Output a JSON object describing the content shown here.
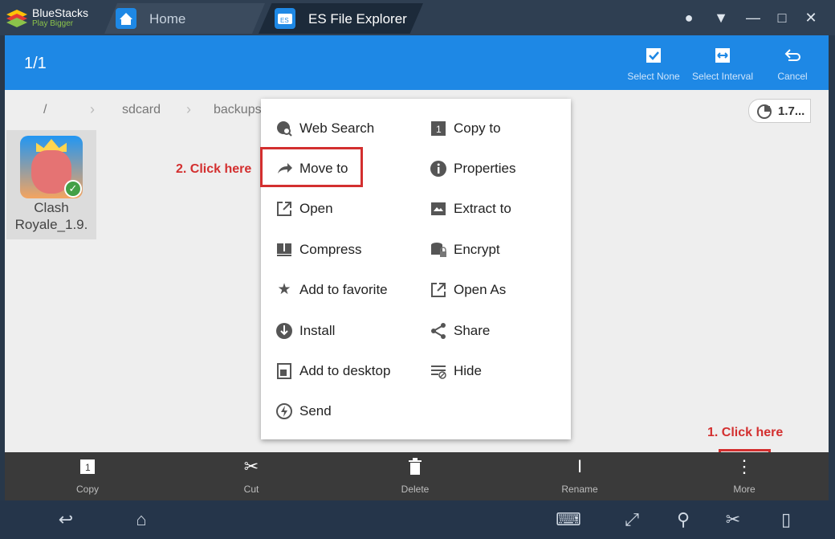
{
  "window": {
    "brand_name": "BlueStacks",
    "brand_tagline": "Play Bigger",
    "tabs": [
      {
        "label": "Home"
      },
      {
        "label": "ES File Explorer"
      }
    ]
  },
  "header": {
    "selection_count": "1/1",
    "actions": [
      {
        "label": "Select None",
        "icon": "checkbox-icon"
      },
      {
        "label": "Select Interval",
        "icon": "interval-icon"
      },
      {
        "label": "Cancel",
        "icon": "undo-icon"
      }
    ]
  },
  "breadcrumb": [
    "/",
    "sdcard",
    "backups"
  ],
  "storage": {
    "value": "1.7..."
  },
  "file": {
    "name": "Clash Royale_1.9."
  },
  "menu": {
    "left": [
      {
        "label": "Web Search",
        "icon": "globe-search-icon"
      },
      {
        "label": "Move to",
        "icon": "move-arrow-icon"
      },
      {
        "label": "Open",
        "icon": "open-external-icon"
      },
      {
        "label": "Compress",
        "icon": "compress-icon"
      },
      {
        "label": "Add to favorite",
        "icon": "star-icon"
      },
      {
        "label": "Install",
        "icon": "install-icon"
      },
      {
        "label": "Add to desktop",
        "icon": "desktop-shortcut-icon"
      },
      {
        "label": "Send",
        "icon": "send-icon"
      }
    ],
    "right": [
      {
        "label": "Copy to",
        "icon": "copy-icon"
      },
      {
        "label": "Properties",
        "icon": "info-icon"
      },
      {
        "label": "Extract to",
        "icon": "extract-icon"
      },
      {
        "label": "Encrypt",
        "icon": "encrypt-icon"
      },
      {
        "label": "Open As",
        "icon": "open-as-icon"
      },
      {
        "label": "Share",
        "icon": "share-icon"
      },
      {
        "label": "Hide",
        "icon": "hide-icon"
      }
    ]
  },
  "annotations": {
    "step1": "1. Click here",
    "step2": "2. Click here"
  },
  "toolbar": [
    {
      "label": "Copy",
      "icon": "copy-icon"
    },
    {
      "label": "Cut",
      "icon": "scissors-icon"
    },
    {
      "label": "Delete",
      "icon": "trash-icon"
    },
    {
      "label": "Rename",
      "icon": "text-cursor-icon"
    },
    {
      "label": "More",
      "icon": "more-vertical-icon"
    }
  ],
  "colors": {
    "accent": "#1e88e5",
    "annotation": "#d32f2f"
  }
}
